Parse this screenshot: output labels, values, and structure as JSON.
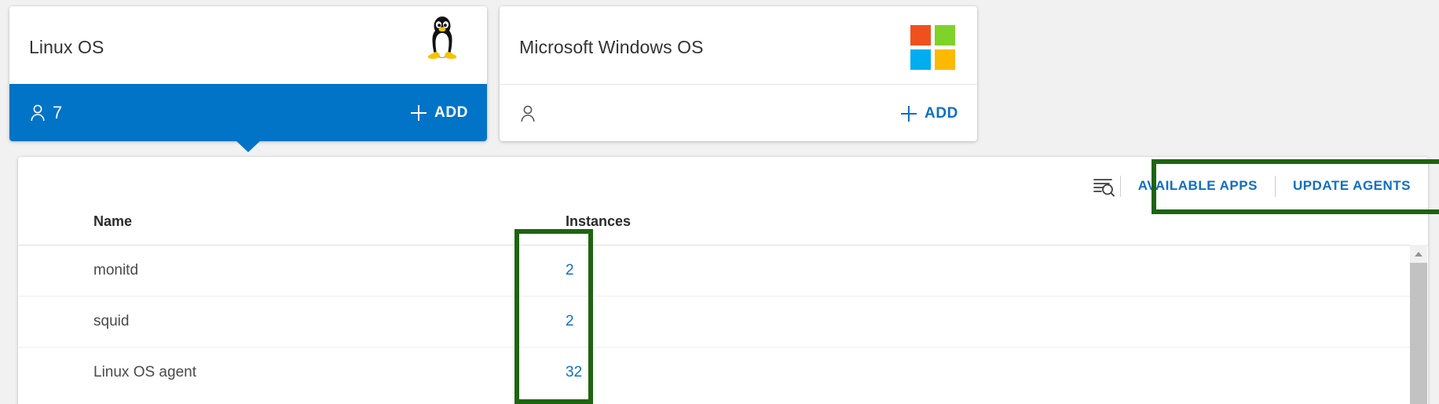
{
  "cards": [
    {
      "title": "Linux OS",
      "logo": "linux-penguin-icon",
      "count": "7",
      "add_label": "ADD",
      "selected": true
    },
    {
      "title": "Microsoft Windows OS",
      "logo": "microsoft-windows-icon",
      "count": "",
      "add_label": "ADD",
      "selected": false
    }
  ],
  "panel": {
    "toolbar": {
      "filter_icon": "filter-search-icon",
      "available_apps_label": "AVAILABLE APPS",
      "update_agents_label": "UPDATE AGENTS"
    },
    "table": {
      "columns": [
        "Name",
        "Instances"
      ],
      "rows": [
        {
          "name": "monitd",
          "instances": "2"
        },
        {
          "name": "squid",
          "instances": "2"
        },
        {
          "name": "Linux OS agent",
          "instances": "32"
        }
      ]
    }
  },
  "colors": {
    "accent_blue": "#0174C7",
    "link_blue": "#0D6FC4",
    "annotation_green": "#1E6411",
    "ms_red": "#F0501E",
    "ms_green": "#7FD22A",
    "ms_blue": "#00ADEF",
    "ms_yellow": "#FBB900"
  }
}
